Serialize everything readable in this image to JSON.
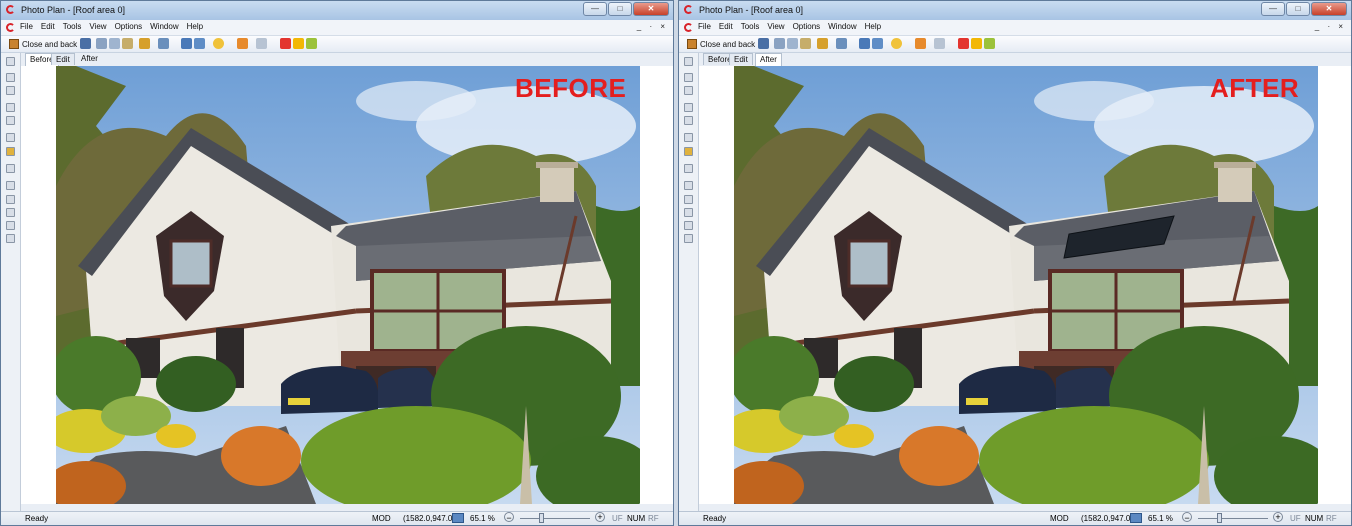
{
  "windows": [
    {
      "id": "before",
      "title": "Photo Plan - [Roof area 0]",
      "menu": [
        "File",
        "Edit",
        "Tools",
        "View",
        "Options",
        "Window",
        "Help"
      ],
      "mdi_controls": "_ · ×",
      "toolbar": {
        "back_label": "Close and back"
      },
      "tabs": [
        {
          "label": "Before",
          "active": true
        },
        {
          "label": "Edit"
        },
        {
          "label": "After"
        }
      ],
      "overlay_label": "BEFORE",
      "has_solar_panel": false,
      "status": {
        "ready": "Ready",
        "mod": "MOD",
        "coords": "(1582.0,947.0)",
        "zoom": "65.1 %",
        "zoom_fraction": 0.3,
        "uf": "UF",
        "num": "NUM",
        "rf": "RF"
      }
    },
    {
      "id": "after",
      "title": "Photo Plan - [Roof area 0]",
      "menu": [
        "File",
        "Edit",
        "Tools",
        "View",
        "Options",
        "Window",
        "Help"
      ],
      "mdi_controls": "_ · ×",
      "toolbar": {
        "back_label": "Close and back"
      },
      "tabs": [
        {
          "label": "Before"
        },
        {
          "label": "Edit"
        },
        {
          "label": "After",
          "active": true
        }
      ],
      "overlay_label": "AFTER",
      "has_solar_panel": true,
      "status": {
        "ready": "Ready",
        "mod": "MOD",
        "coords": "(1582.0,947.0)",
        "zoom": "65.1 %",
        "zoom_fraction": 0.3,
        "uf": "UF",
        "num": "NUM",
        "rf": "RF"
      }
    }
  ],
  "colors": {
    "overlay": "#e41e1e",
    "close_button": "#c7402a",
    "titlebar": "#b5cde9"
  },
  "icons": [
    "app-logo-icon",
    "minimize-icon",
    "maximize-icon",
    "close-icon",
    "close-and-back-icon",
    "save-icon",
    "print-icon",
    "zoom-icon",
    "star-icon"
  ]
}
